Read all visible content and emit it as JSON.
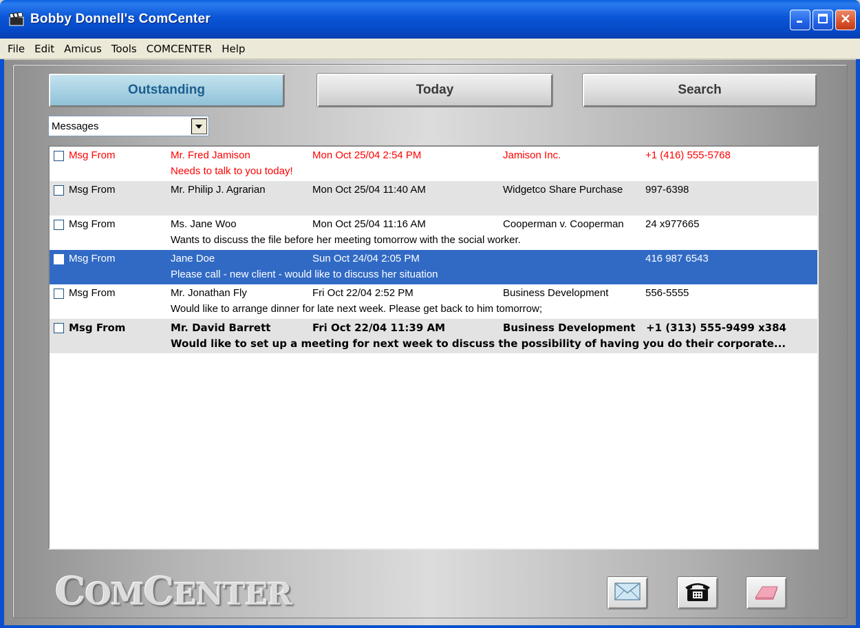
{
  "window": {
    "title": "Bobby Donnell's ComCenter",
    "icon": "director-clapper-icon"
  },
  "menu": [
    "File",
    "Edit",
    "Amicus",
    "Tools",
    "COMCENTER",
    "Help"
  ],
  "tabs": {
    "outstanding": "Outstanding",
    "today": "Today",
    "search": "Search",
    "active": "Outstanding"
  },
  "filter": {
    "selected": "Messages"
  },
  "messages": [
    {
      "type": "Msg From",
      "name": "Mr. Fred Jamison",
      "date": "Mon Oct 25/04 2:54 PM",
      "matter": "Jamison Inc.",
      "phone": "+1 (416) 555-5768",
      "note": "Needs to talk to you today!",
      "style": "urgent"
    },
    {
      "type": "Msg From",
      "name": "Mr. Philip J. Agrarian",
      "date": "Mon Oct 25/04 11:40 AM",
      "matter": "Widgetco Share Purchase",
      "phone": "997-6398",
      "note": "",
      "style": "normal"
    },
    {
      "type": "Msg From",
      "name": "Ms. Jane Woo",
      "date": "Mon Oct 25/04 11:16 AM",
      "matter": "Cooperman v. Cooperman",
      "phone": "24 x977665",
      "note": "Wants to discuss the file before her meeting tomorrow with the social worker.",
      "style": "normal"
    },
    {
      "type": "Msg From",
      "name": "Jane Doe",
      "date": "Sun Oct 24/04 2:05 PM",
      "matter": "",
      "phone": "416 987 6543",
      "note": "Please call - new client - would like to discuss her situation",
      "style": "selected"
    },
    {
      "type": "Msg From",
      "name": "Mr. Jonathan Fly",
      "date": "Fri Oct 22/04 2:52 PM",
      "matter": "Business Development",
      "phone": "556-5555",
      "note": "Would like to arrange dinner for late next week. Please get back to him tomorrow;",
      "style": "normal"
    },
    {
      "type": "Msg From",
      "name": "Mr. David Barrett",
      "date": "Fri Oct 22/04 11:39 AM",
      "matter": "Business Development",
      "phone": "+1 (313) 555-9499 x384",
      "note": "Would like to set up a meeting for next week to discuss the possibility of having you do their corporate...",
      "style": "unread"
    }
  ],
  "footer": {
    "logo_big_1": "C",
    "logo_small_1": "OM",
    "logo_big_2": "C",
    "logo_small_2": "ENTER",
    "buttons": [
      "envelope-icon",
      "telephone-icon",
      "eraser-icon"
    ]
  },
  "colors": {
    "urgent": "#ff0000",
    "selected_row": "#316ac5",
    "alt_row": "#e3e3e3",
    "active_tab_text": "#1b5e8e"
  }
}
